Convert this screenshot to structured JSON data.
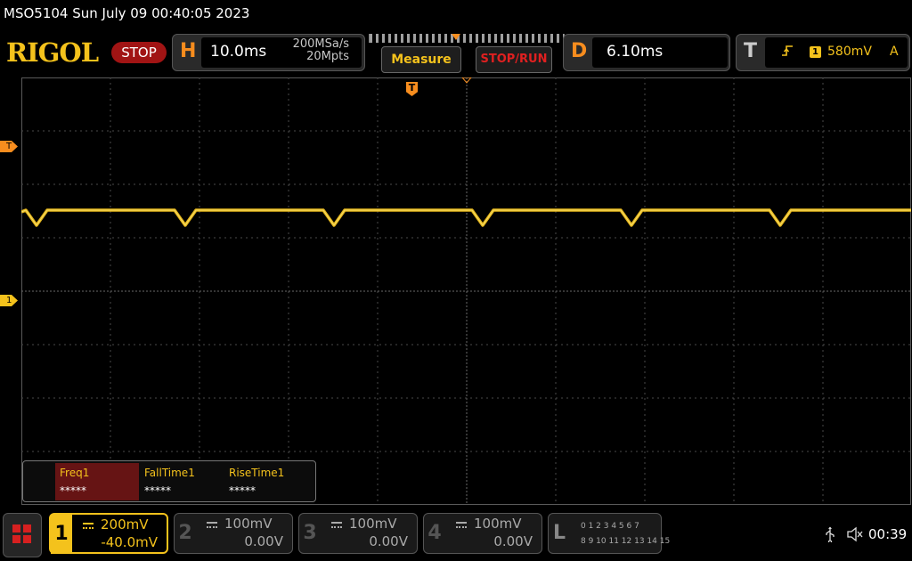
{
  "header": {
    "title": "MSO5104  Sun July 09 00:40:05 2023"
  },
  "logo": {
    "text": "RIGOL"
  },
  "run_state": {
    "label": "STOP"
  },
  "horizontal": {
    "letter": "H",
    "timebase": "10.0ms",
    "sample_rate": "200MSa/s",
    "memory_depth": "20Mpts"
  },
  "buttons": {
    "measure": "Measure",
    "stop_run": "STOP/RUN"
  },
  "delay": {
    "letter": "D",
    "value": "6.10ms"
  },
  "trigger": {
    "letter": "T",
    "edge_icon": "rising-edge-icon",
    "source": "1",
    "level": "580mV",
    "mode": "A",
    "marker_label": "T"
  },
  "waveform": {
    "color": "#f4c21c",
    "channel_marker": "1",
    "dip_count": 6
  },
  "measurements": [
    {
      "name": "Freq1",
      "value": "*****",
      "active": true
    },
    {
      "name": "FallTime1",
      "value": "*****",
      "active": false
    },
    {
      "name": "RiseTime1",
      "value": "*****",
      "active": false
    }
  ],
  "channels": [
    {
      "number": "1",
      "scale": "200mV",
      "offset": "-40.0mV",
      "active": true,
      "color": "#f4c21c"
    },
    {
      "number": "2",
      "scale": "100mV",
      "offset": "0.00V",
      "active": false
    },
    {
      "number": "3",
      "scale": "100mV",
      "offset": "0.00V",
      "active": false
    },
    {
      "number": "4",
      "scale": "100mV",
      "offset": "0.00V",
      "active": false
    }
  ],
  "logic": {
    "letter": "L",
    "row1": "0 1 2 3   4 5 6 7",
    "row2": "8  9 10 11  12 13 14 15"
  },
  "status": {
    "usb_icon": "usb-icon",
    "speaker_icon": "speaker-muted-icon",
    "clock": "00:39"
  },
  "colors": {
    "accent_orange": "#f78d1e",
    "channel1_yellow": "#f4c21c",
    "stop_red": "#a11414"
  }
}
